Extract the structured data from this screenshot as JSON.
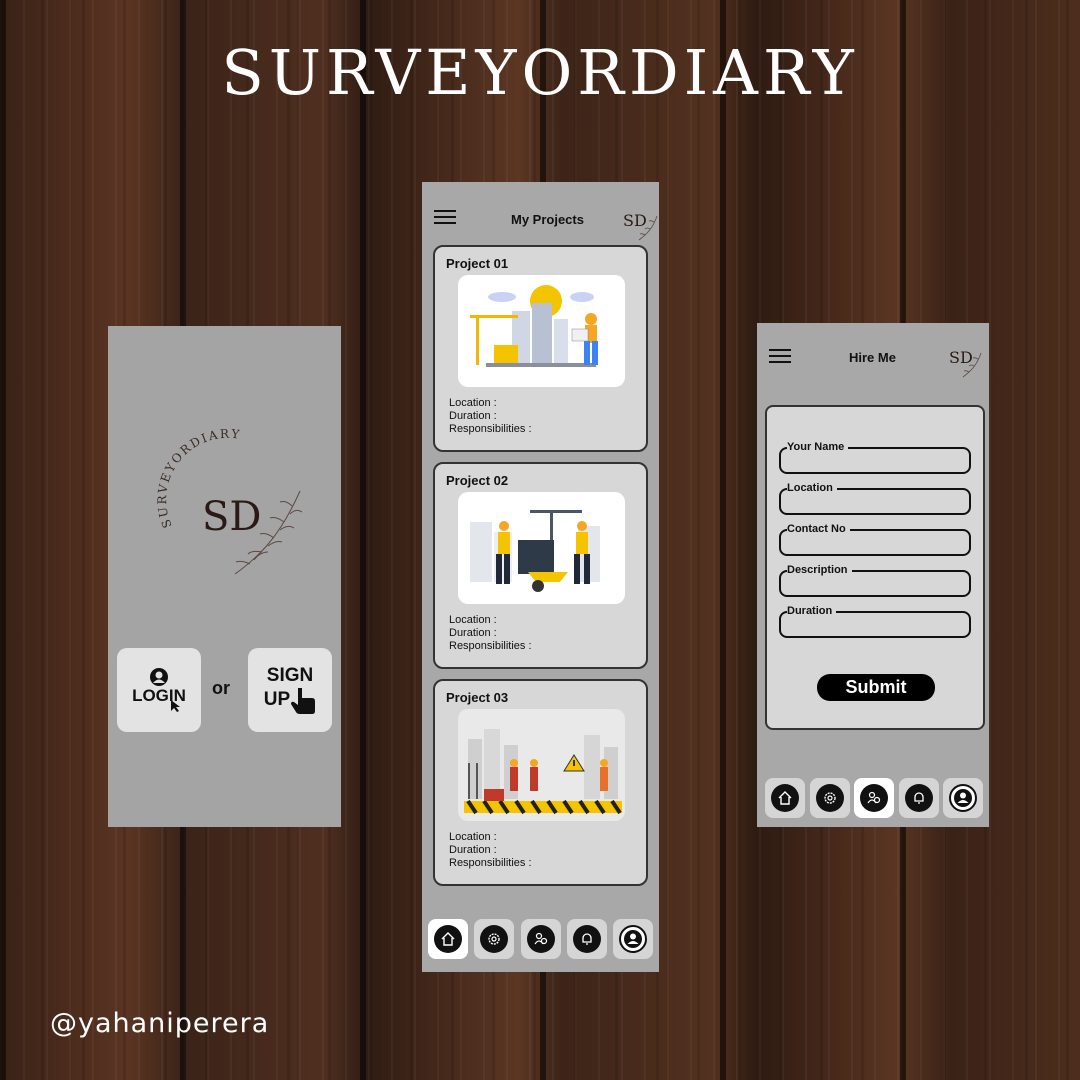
{
  "page": {
    "headline": "SURVEYORDIARY",
    "handle": "@yahaniperera"
  },
  "brand": {
    "arc_text": "SURVEYORDIARY",
    "monogram": "SD"
  },
  "login_screen": {
    "login_label": "LOGIN",
    "or_label": "or",
    "signup_label_line1": "SIGN",
    "signup_label_line2": "UP"
  },
  "projects_screen": {
    "title": "My Projects",
    "projects": [
      {
        "title": "Project 01",
        "location_label": "Location :",
        "duration_label": "Duration :",
        "responsibilities_label": "Responsibilities :"
      },
      {
        "title": "Project 02",
        "location_label": "Location :",
        "duration_label": "Duration :",
        "responsibilities_label": "Responsibilities :"
      },
      {
        "title": "Project 03",
        "location_label": "Location :",
        "duration_label": "Duration :",
        "responsibilities_label": "Responsibilities :"
      }
    ],
    "active_nav": "home"
  },
  "hire_screen": {
    "title": "Hire Me",
    "fields": [
      "Your Name",
      "Location",
      "Contact No",
      "Description",
      "Duration"
    ],
    "submit_label": "Submit",
    "active_nav": "hire"
  },
  "nav_icons": [
    "home-icon",
    "gear-icon",
    "hire-icon",
    "bell-icon",
    "profile-icon"
  ],
  "colors": {
    "screen_bg": "#a8a8a8",
    "card_bg": "#d7d7d7",
    "accent_yellow": "#f5c400",
    "worker_blue": "#3b82f6"
  }
}
